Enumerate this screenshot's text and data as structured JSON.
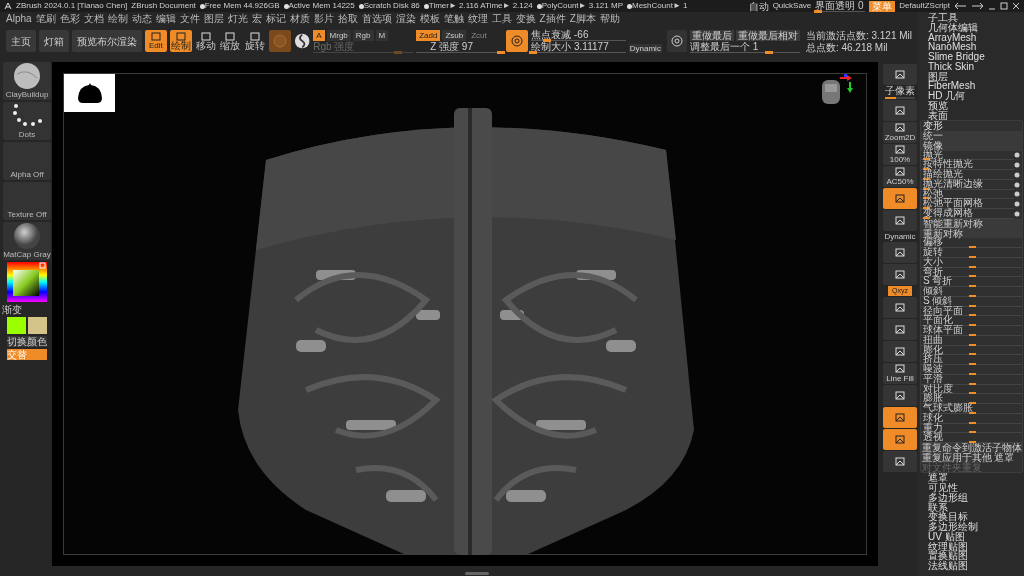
{
  "title_bar": {
    "app": "ZBrush 2024.0.1 [Tianao Chen]",
    "document": "ZBrush Document",
    "stats": [
      "Free Mem 44.926GB",
      "Active Mem 14225",
      "Scratch Disk 86",
      "Timer► 2.116 ATime► 2.124",
      "PolyCount► 3.121 MP",
      "MeshCount► 1"
    ],
    "autosave": "自动",
    "quicksave": "QuickSave",
    "transparency": {
      "label": "界面透明 0",
      "level": 0.05
    },
    "menu_button": {
      "label": "菜单",
      "selected": true
    },
    "script": "DefaultZScript"
  },
  "menu_bar": [
    "Alpha",
    "笔刷",
    "色彩",
    "文档",
    "绘制",
    "动态",
    "编辑",
    "文件",
    "图层",
    "灯光",
    "宏",
    "标记",
    "材质",
    "影片",
    "拾取",
    "首选项",
    "渲染",
    "模板",
    "笔触",
    "纹理",
    "工具",
    "变换",
    "Z插件",
    "Z脚本",
    "帮助"
  ],
  "toolbar": {
    "nav_buttons": [
      "主页",
      "灯箱",
      "预览布尔渲染"
    ],
    "modes": [
      {
        "label": "Edit",
        "selected": true
      },
      {
        "label": "绘制",
        "selected": true
      },
      {
        "label": "移动",
        "selected": false
      },
      {
        "label": "缩放",
        "selected": false
      },
      {
        "label": "旋转",
        "selected": false
      }
    ],
    "material": {
      "selected": true
    },
    "channels": [
      {
        "label": "A",
        "selected": true
      },
      {
        "label": "Mrgb",
        "selected": false
      },
      {
        "label": "Rgb",
        "selected": false
      },
      {
        "label": "M",
        "selected": false
      }
    ],
    "rgb_intensity": {
      "label": "Rgb 强度",
      "level": 0.85,
      "disabled": true
    },
    "z_modes": [
      {
        "label": "Zadd",
        "selected": true,
        "disabled": false
      },
      {
        "label": "Zsub",
        "selected": false,
        "disabled": false
      },
      {
        "label": "Zcut",
        "selected": false,
        "disabled": true
      }
    ],
    "z_intensity": {
      "label": "Z 强度 97",
      "level": 0.97
    },
    "focal_shift": {
      "label": "焦点衰减 -66",
      "level": 0.17
    },
    "draw_size": {
      "label": "绘制大小 3.11177",
      "level": 0.02
    },
    "dynamic": "Dynamic",
    "redo_buttons": [
      "重做最后",
      "重做最后相对"
    ],
    "adjust_last": {
      "label": "调整最后一个 1",
      "level": 0.72
    },
    "stats": [
      "当前激活点数: 3.121 Mil",
      "总点数: 46.218 Mil"
    ]
  },
  "left_panel": {
    "thumbs": [
      {
        "label": "ClayBuildup",
        "kind": "sphere"
      },
      {
        "label": "Dots",
        "kind": "dots"
      },
      {
        "label": "Alpha Off",
        "kind": "empty"
      },
      {
        "label": "Texture Off",
        "kind": "empty"
      },
      {
        "label": "MatCap Gray",
        "kind": "matcap"
      }
    ],
    "gradient": "渐变",
    "swatches": [
      {
        "color": "#99ff00"
      },
      {
        "color": "#d4c48a"
      }
    ],
    "switch_color": "切换颜色",
    "alternate": {
      "label": "交替",
      "selected": true
    }
  },
  "right_toolbar": [
    {
      "kind": "button",
      "label": "子像素",
      "selected": false,
      "level": 0.35
    },
    {
      "kind": "button",
      "selected": false
    },
    {
      "kind": "button",
      "label": "Zoom2D",
      "selected": false
    },
    {
      "kind": "button",
      "label": "100%",
      "selected": false
    },
    {
      "kind": "button",
      "label": "AC50%",
      "selected": false
    },
    {
      "kind": "button",
      "selected": true
    },
    {
      "kind": "button",
      "selected": false
    },
    {
      "kind": "text",
      "label": "Dynamic"
    },
    {
      "kind": "button",
      "selected": false
    },
    {
      "kind": "button",
      "selected": false
    },
    {
      "kind": "toggle",
      "label": "Qxyz",
      "selected": true
    },
    {
      "kind": "button",
      "selected": false
    },
    {
      "kind": "button",
      "selected": false
    },
    {
      "kind": "button",
      "selected": false
    },
    {
      "kind": "button",
      "label": "Line Fill",
      "selected": false
    },
    {
      "kind": "button",
      "selected": false
    },
    {
      "kind": "button",
      "selected": true
    },
    {
      "kind": "button",
      "selected": true
    },
    {
      "kind": "button",
      "selected": false
    }
  ],
  "tool_menu": {
    "items": [
      "子工具",
      "几何体编辑",
      "ArrayMesh",
      "NanoMesh",
      "Slime Bridge",
      "Thick Skin",
      "图层",
      "FiberMesh",
      "HD 几何",
      "预览",
      "表面"
    ],
    "deformation": {
      "title": "变形",
      "rows": [
        {
          "kind": "button",
          "label": "统一"
        },
        {
          "kind": "button",
          "label": "镜像"
        },
        {
          "kind": "toggle",
          "label": "抛光",
          "level": 0.05
        },
        {
          "kind": "toggle",
          "label": "按特性抛光",
          "level": 0.05
        },
        {
          "kind": "toggle",
          "label": "描绘抛光",
          "level": 0.05
        },
        {
          "kind": "toggle",
          "label": "抛光清晰边缘",
          "level": 0.05
        },
        {
          "kind": "toggle",
          "label": "松弛",
          "level": 0.05
        },
        {
          "kind": "toggle",
          "label": "松弛平面网格",
          "level": 0.05
        },
        {
          "kind": "toggle",
          "label": "变得成网格",
          "level": 0.05
        },
        {
          "kind": "button",
          "label": "智能重新对称"
        },
        {
          "kind": "button",
          "label": "重新对称"
        },
        {
          "kind": "slider",
          "label": "偏移",
          "level": 0.5
        },
        {
          "kind": "slider",
          "label": "旋转",
          "level": 0.5
        },
        {
          "kind": "slider",
          "label": "大小",
          "level": 0.5
        },
        {
          "kind": "slider",
          "label": "弯折",
          "level": 0.5
        },
        {
          "kind": "slider",
          "label": "S 弯折",
          "level": 0.5
        },
        {
          "kind": "slider",
          "label": "倾斜",
          "level": 0.5
        },
        {
          "kind": "slider",
          "label": "S 倾斜",
          "level": 0.5
        },
        {
          "kind": "slider",
          "label": "径向平面",
          "level": 0.5
        },
        {
          "kind": "slider",
          "label": "平面化",
          "level": 0.5
        },
        {
          "kind": "slider",
          "label": "球体平面",
          "level": 0.5
        },
        {
          "kind": "slider",
          "label": "扭曲",
          "level": 0.5
        },
        {
          "kind": "slider",
          "label": "膨化",
          "level": 0.5
        },
        {
          "kind": "slider",
          "label": "挤压",
          "level": 0.5
        },
        {
          "kind": "slider",
          "label": "噪波",
          "level": 0.5
        },
        {
          "kind": "slider",
          "label": "平滑",
          "level": 0.5
        },
        {
          "kind": "slider",
          "label": "对比度",
          "level": 0.5
        },
        {
          "kind": "slider",
          "label": "膨胀",
          "level": 0.5
        },
        {
          "kind": "slider",
          "label": "气球式膨胀",
          "level": 0.5
        },
        {
          "kind": "slider",
          "label": "球化",
          "level": 0.5
        },
        {
          "kind": "slider",
          "label": "重力",
          "level": 0.5
        },
        {
          "kind": "slider",
          "label": "透视",
          "level": 0.5
        }
      ],
      "repeat_to_subtools": "重复命令到激活子物体",
      "repeat_to_other": "重复应用于其他",
      "mask": "遮罩",
      "repeat_folder": "对文件夹重复"
    },
    "more_items": [
      "遮罩",
      "可见性",
      "多边形组",
      "联系",
      "变换目标",
      "多边形绘制",
      "UV 贴图",
      "纹理贴图",
      "置换贴图",
      "法线贴图"
    ]
  }
}
